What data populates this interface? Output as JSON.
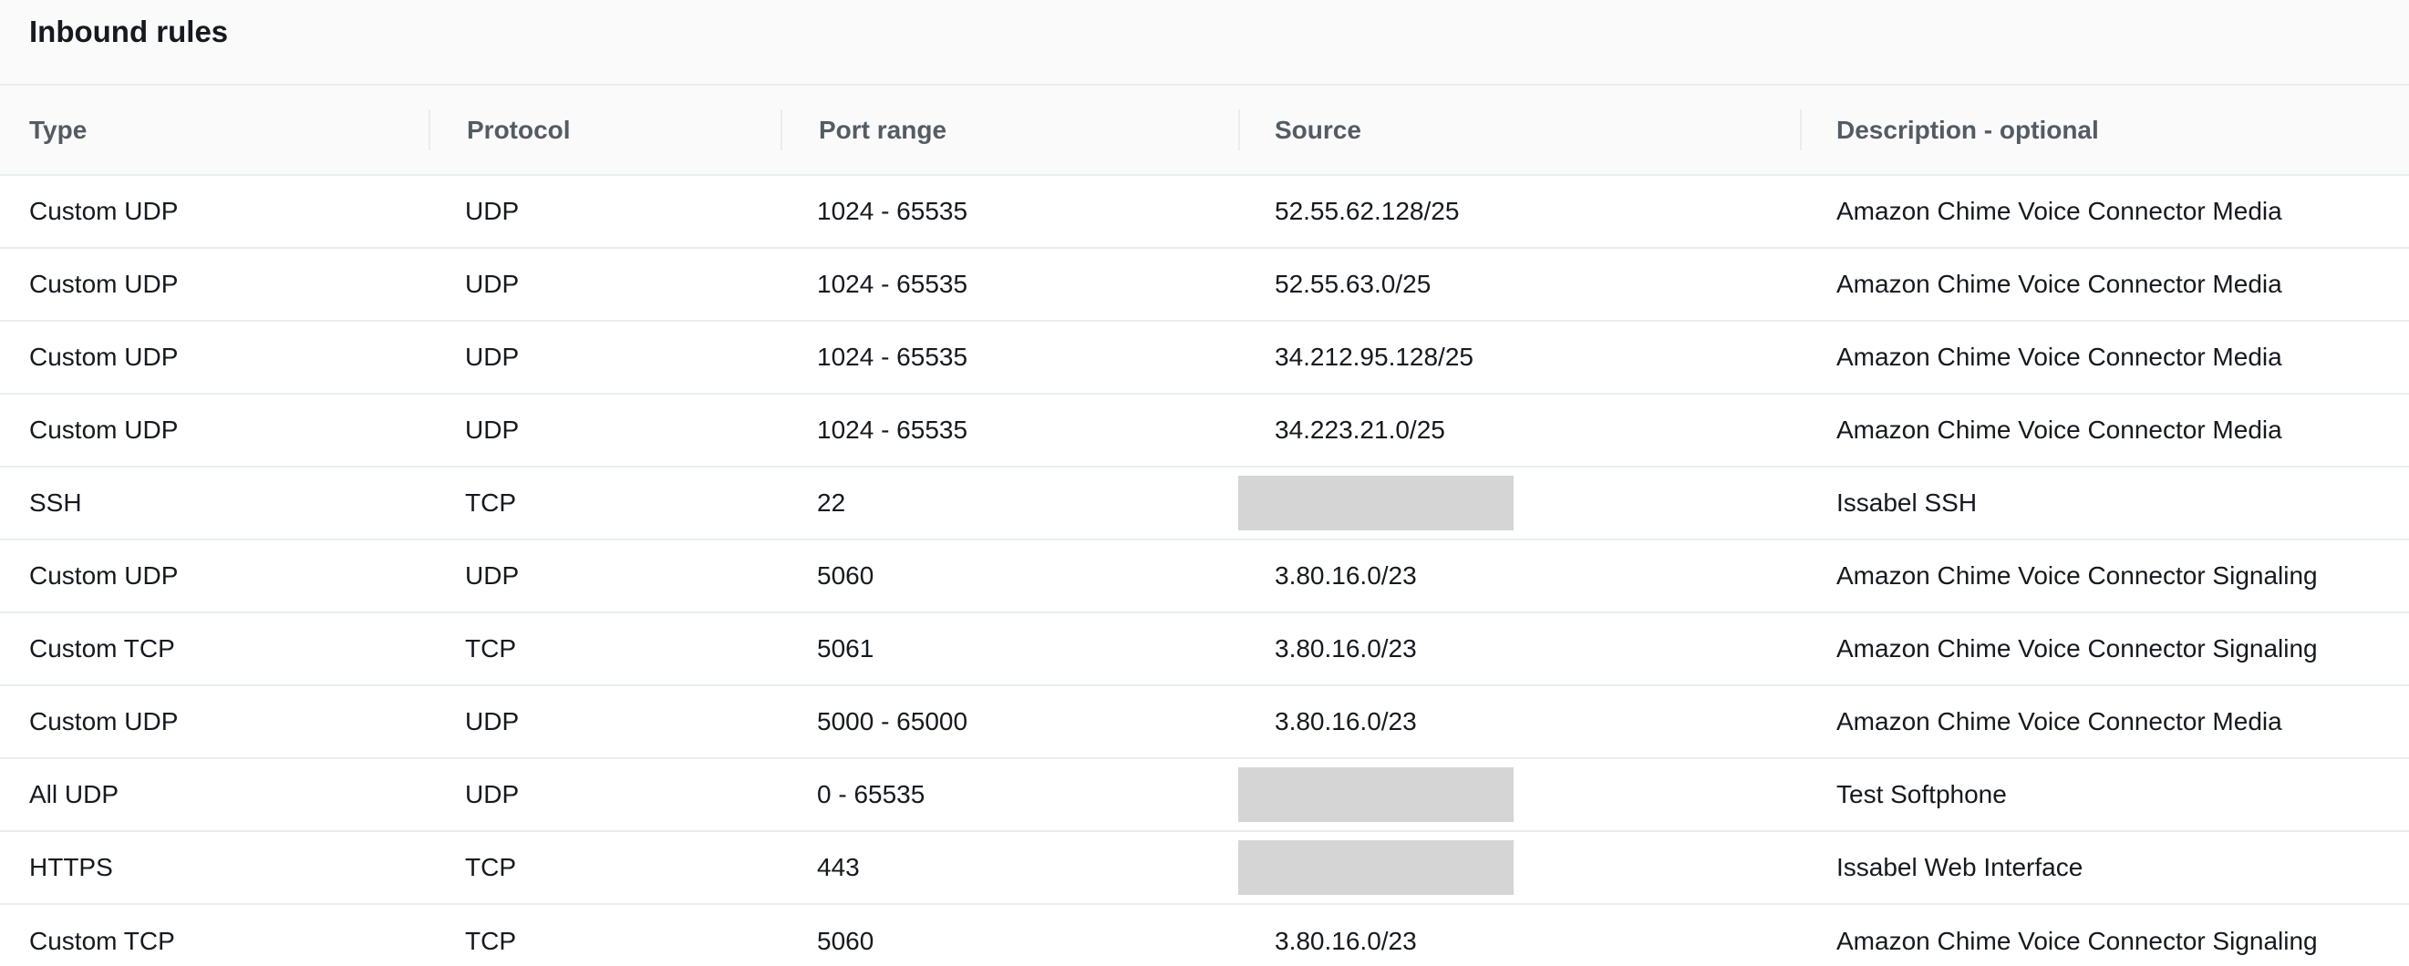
{
  "panel": {
    "title": "Inbound rules"
  },
  "table": {
    "columns": [
      "Type",
      "Protocol",
      "Port range",
      "Source",
      "Description - optional"
    ],
    "rows": [
      {
        "type": "Custom UDP",
        "protocol": "UDP",
        "port_range": "1024 - 65535",
        "source": "52.55.62.128/25",
        "description": "Amazon Chime Voice Connector Media"
      },
      {
        "type": "Custom UDP",
        "protocol": "UDP",
        "port_range": "1024 - 65535",
        "source": "52.55.63.0/25",
        "description": "Amazon Chime Voice Connector Media"
      },
      {
        "type": "Custom UDP",
        "protocol": "UDP",
        "port_range": "1024 - 65535",
        "source": "34.212.95.128/25",
        "description": "Amazon Chime Voice Connector Media"
      },
      {
        "type": "Custom UDP",
        "protocol": "UDP",
        "port_range": "1024 - 65535",
        "source": "34.223.21.0/25",
        "description": "Amazon Chime Voice Connector Media"
      },
      {
        "type": "SSH",
        "protocol": "TCP",
        "port_range": "22",
        "source": "",
        "description": "Issabel SSH"
      },
      {
        "type": "Custom UDP",
        "protocol": "UDP",
        "port_range": "5060",
        "source": "3.80.16.0/23",
        "description": "Amazon Chime Voice Connector Signaling"
      },
      {
        "type": "Custom TCP",
        "protocol": "TCP",
        "port_range": "5061",
        "source": "3.80.16.0/23",
        "description": "Amazon Chime Voice Connector Signaling"
      },
      {
        "type": "Custom UDP",
        "protocol": "UDP",
        "port_range": "5000 - 65000",
        "source": "3.80.16.0/23",
        "description": "Amazon Chime Voice Connector Media"
      },
      {
        "type": "All UDP",
        "protocol": "UDP",
        "port_range": "0 - 65535",
        "source": "",
        "description": "Test Softphone"
      },
      {
        "type": "HTTPS",
        "protocol": "TCP",
        "port_range": "443",
        "source": "",
        "description": "Issabel Web Interface"
      },
      {
        "type": "Custom TCP",
        "protocol": "TCP",
        "port_range": "5060",
        "source": "3.80.16.0/23",
        "description": "Amazon Chime Voice Connector Signaling"
      }
    ]
  }
}
